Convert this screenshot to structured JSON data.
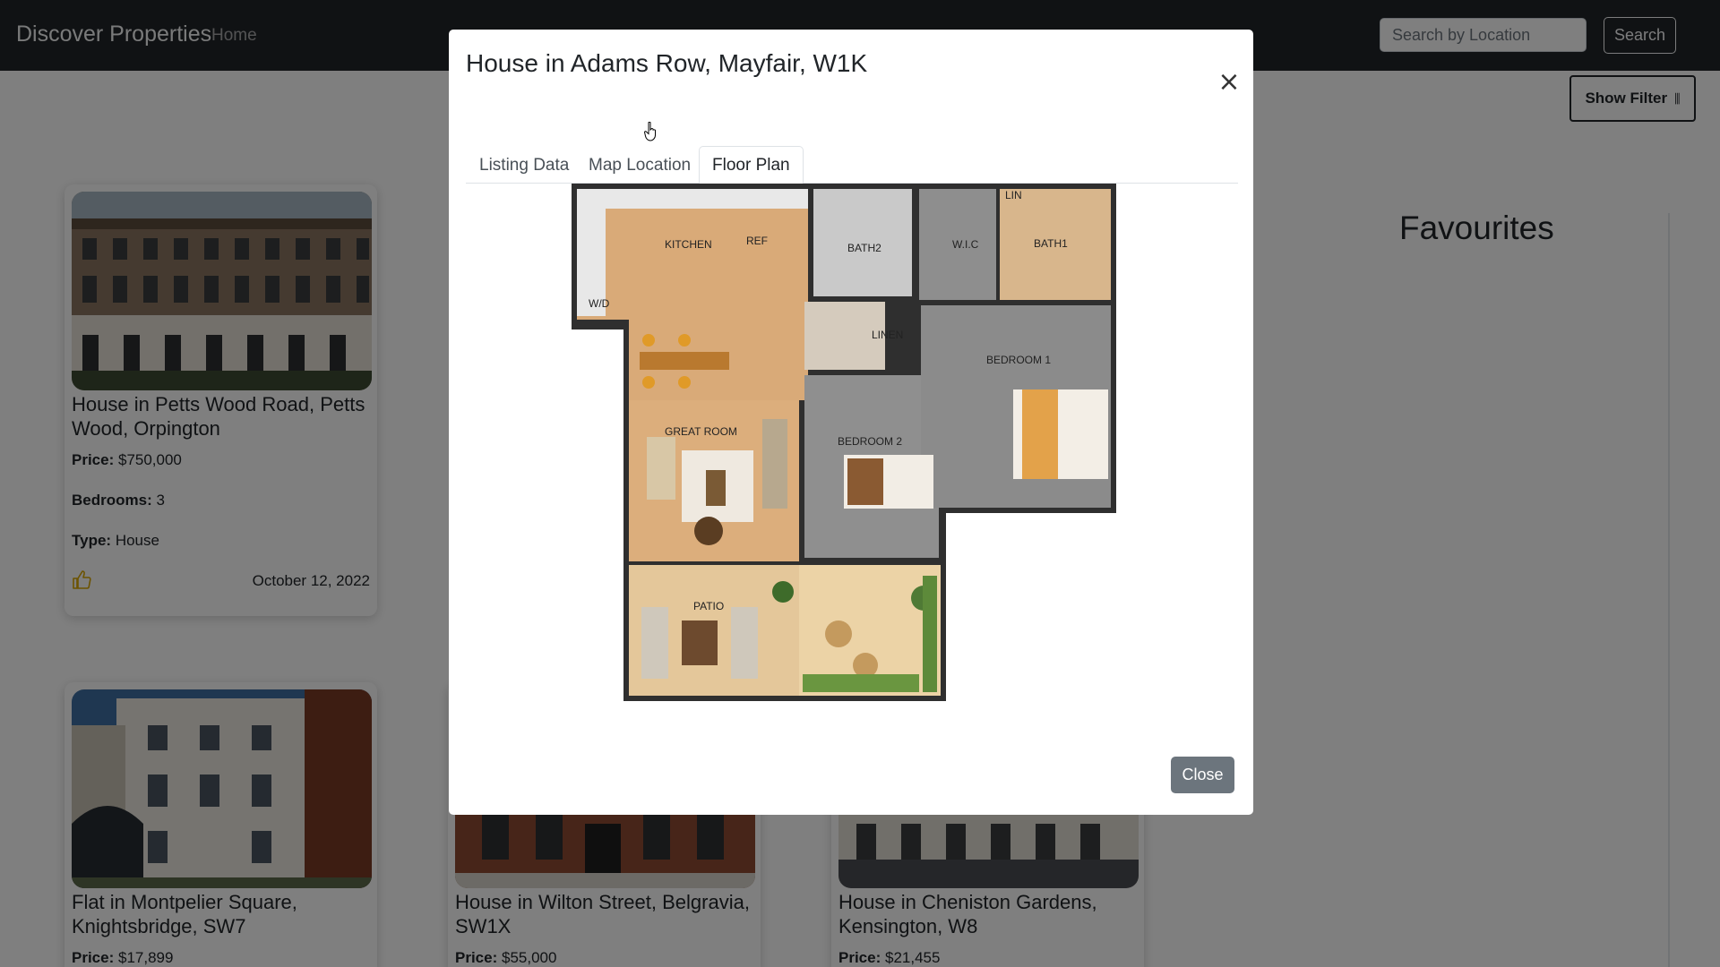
{
  "navbar": {
    "brand": "Discover Properties",
    "home": "Home",
    "search_placeholder": "Search by Location",
    "search_button": "Search"
  },
  "filter_button": {
    "label": "Show Filter",
    "icon": "sliders-icon"
  },
  "favourites": {
    "title": "Favourites"
  },
  "cards": [
    {
      "title": "House in Petts Wood Road, Petts Wood, Orpington",
      "price_label": "Price:",
      "price": "$750,000",
      "bedrooms_label": "Bedrooms:",
      "bedrooms": "3",
      "type_label": "Type:",
      "type": "House",
      "date": "October 12, 2022",
      "like_icon": "thumbs-up-icon"
    },
    {
      "title": "Flat in Montpelier Square, Knightsbridge, SW7",
      "price_label": "Price:",
      "price": "$17,899"
    },
    {
      "title": "House in Wilton Street, Belgravia, SW1X",
      "price_label": "Price:",
      "price": "$55,000"
    },
    {
      "title": "House in Cheniston Gardens, Kensington, W8",
      "price_label": "Price:",
      "price": "$21,455"
    }
  ],
  "modal": {
    "title": "House in Adams Row, Mayfair, W1K",
    "tabs": [
      "Listing Data",
      "Map Location",
      "Floor Plan"
    ],
    "active_tab": "Floor Plan",
    "close_label": "Close",
    "floor_plan_labels": {
      "kitchen": "KITCHEN",
      "ref": "REF",
      "bath2": "BATH2",
      "wic": "W.I.C",
      "lin": "LIN",
      "bath1": "BATH1",
      "wd": "W/D",
      "linen": "LINEN",
      "bedroom1": "BEDROOM 1",
      "great_room": "GREAT ROOM",
      "bedroom2": "BEDROOM 2",
      "patio": "PATIO"
    }
  },
  "colors": {
    "navbar": "#212529",
    "close_button": "#6c757d",
    "like": "#d8a600"
  }
}
